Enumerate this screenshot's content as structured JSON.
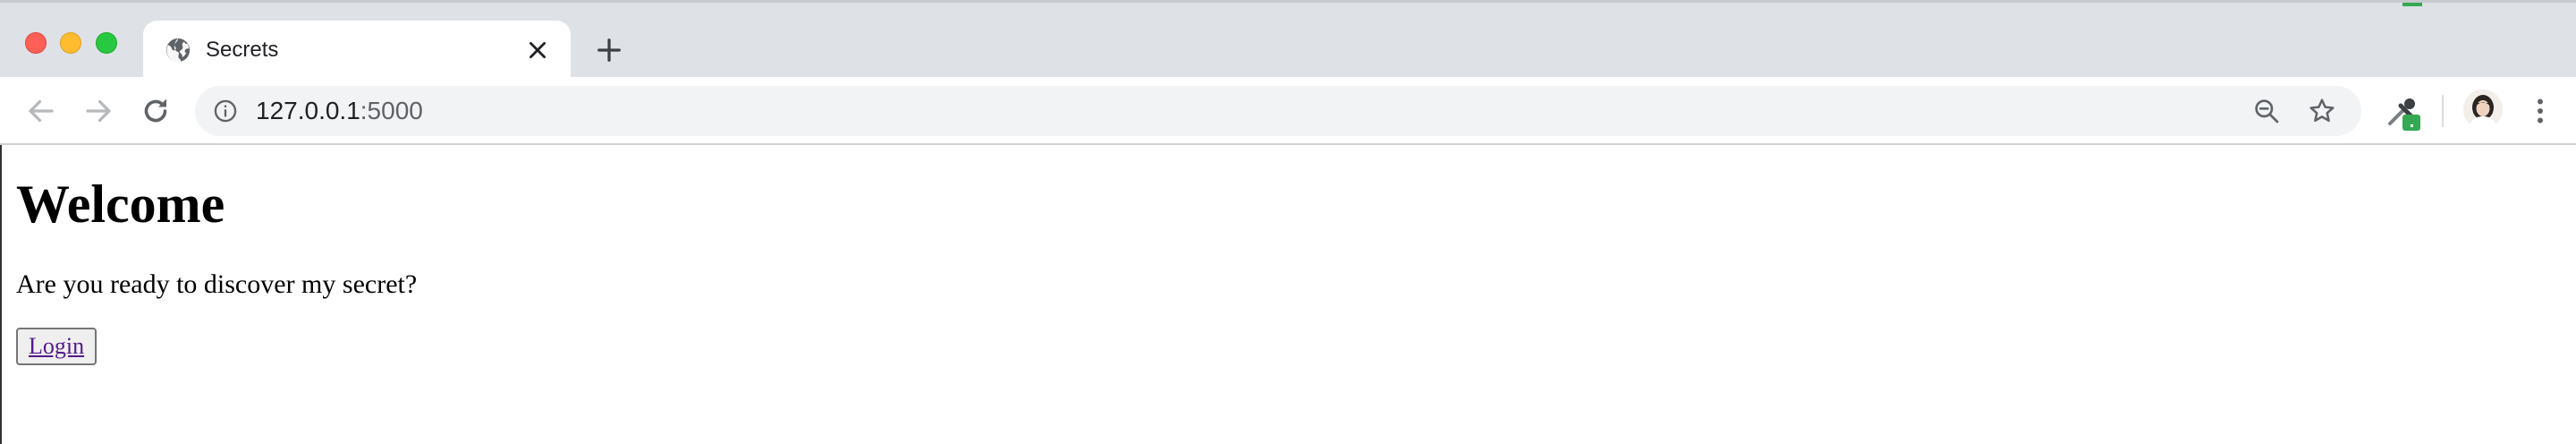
{
  "browser": {
    "tab": {
      "title": "Secrets",
      "favicon": "globe-icon",
      "close_icon": "close-icon"
    },
    "new_tab_icon": "plus-icon",
    "toolbar": {
      "back_icon": "arrow-left-icon",
      "forward_icon": "arrow-right-icon",
      "reload_icon": "reload-icon",
      "info_icon": "info-icon",
      "url_host": "127.0.0.1",
      "url_port": ":5000",
      "zoom_icon": "zoom-out-icon",
      "bookmark_icon": "star-icon",
      "extension_icon": "eyedropper-extension-icon",
      "profile_icon": "avatar",
      "menu_icon": "kebab-menu-icon"
    },
    "colors": {
      "tab_strip": "#dee1e6",
      "omnibox": "#f1f3f4",
      "traffic_red": "#fe5f57",
      "traffic_yellow": "#febc2e",
      "traffic_green": "#28c840",
      "link": "#551a8b",
      "extension_badge": "#34a853"
    }
  },
  "page": {
    "heading": "Welcome",
    "lead": "Are you ready to discover my secret?",
    "login_label": "Login"
  }
}
